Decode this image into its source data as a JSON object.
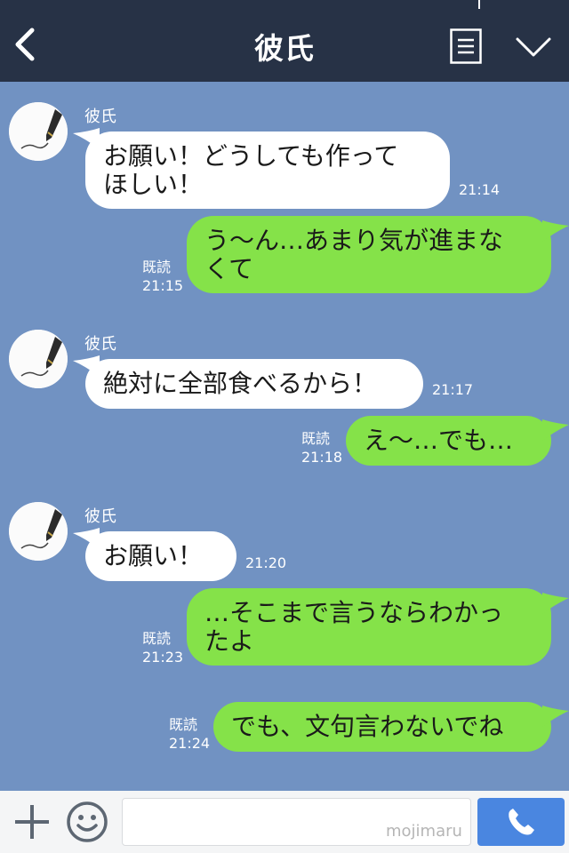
{
  "header": {
    "title": "彼氏",
    "icons": {
      "back": "chevron-left-icon",
      "menu": "list-menu-icon",
      "more": "chevron-down-icon"
    }
  },
  "messages": [
    {
      "dir": "in",
      "sender": "彼氏",
      "text": "お願い！どうしても作って\nほしい！",
      "time": "21:14"
    },
    {
      "dir": "out",
      "read": "既読",
      "text": "う〜ん…あまり気が進まな\nくて",
      "time": "21:15"
    },
    {
      "dir": "in",
      "sender": "彼氏",
      "text": "絶対に全部食べるから！",
      "time": "21:17"
    },
    {
      "dir": "out",
      "read": "既読",
      "text": "え〜…でも…",
      "time": "21:18"
    },
    {
      "dir": "in",
      "sender": "彼氏",
      "text": "お願い！",
      "time": "21:20"
    },
    {
      "dir": "out",
      "read": "既読",
      "text": "…そこまで言うならわかっ\nたよ",
      "time": "21:23"
    },
    {
      "dir": "out",
      "read": "既読",
      "text": "でも、文句言わないでね",
      "time": "21:24"
    }
  ],
  "footer": {
    "watermark": "mojimaru",
    "input_value": "",
    "icons": {
      "add": "plus-icon",
      "sticker": "smiley-icon",
      "call": "phone-icon"
    }
  },
  "colors": {
    "header_bg": "#273246",
    "chat_bg": "#7192c2",
    "incoming_bubble": "#ffffff",
    "outgoing_bubble": "#85e249",
    "call_button": "#4a86e0"
  }
}
